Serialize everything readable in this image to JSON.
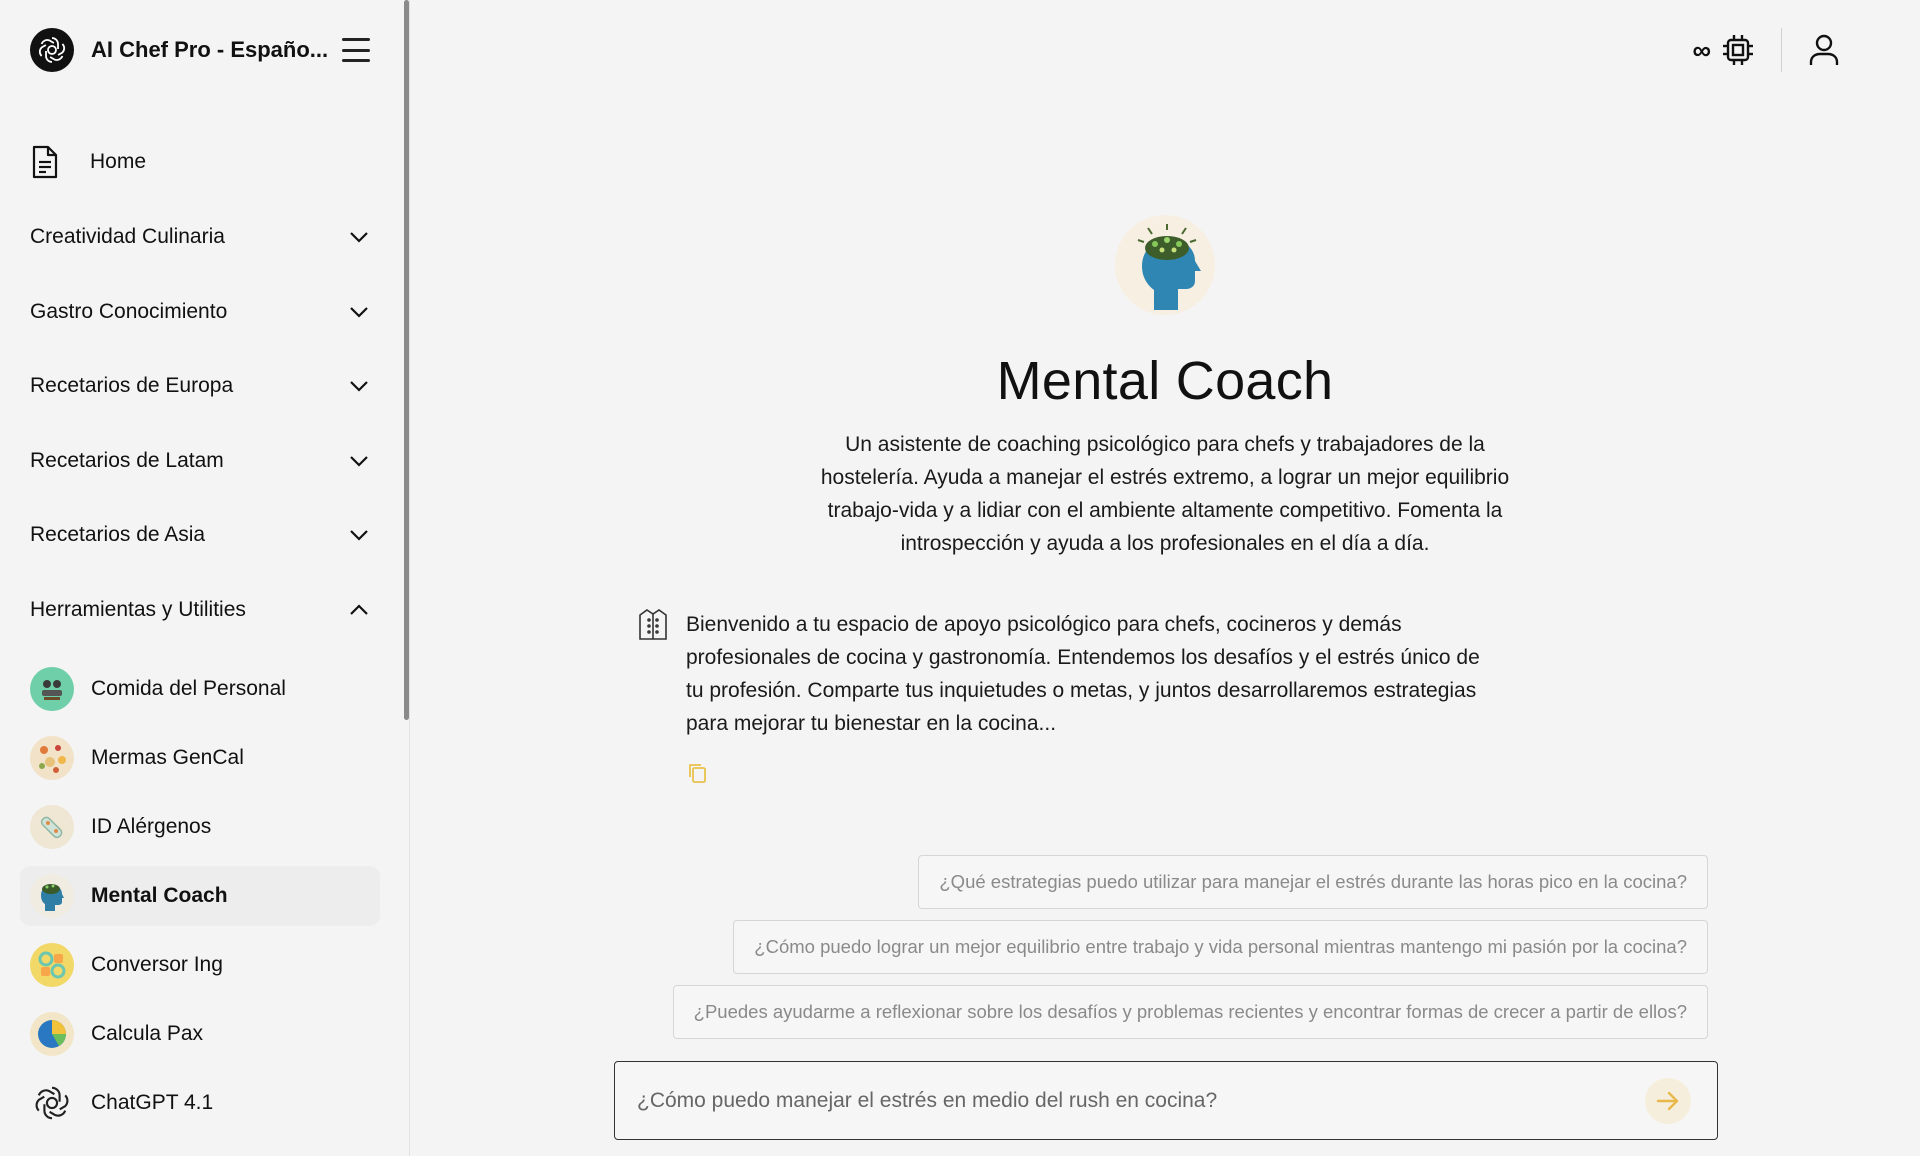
{
  "app": {
    "title": "AI Chef Pro - Españo..."
  },
  "sidebar": {
    "home_label": "Home",
    "sections": [
      {
        "label": "Creatividad Culinaria",
        "state": "collapsed"
      },
      {
        "label": "Gastro Conocimiento",
        "state": "collapsed"
      },
      {
        "label": "Recetarios de Europa",
        "state": "collapsed"
      },
      {
        "label": "Recetarios de Latam",
        "state": "collapsed"
      },
      {
        "label": "Recetarios de Asia",
        "state": "collapsed"
      },
      {
        "label": "Herramientas y Utilities",
        "state": "expanded"
      }
    ],
    "tools": [
      {
        "label": "Comida del Personal",
        "icon": "staff-meal-icon"
      },
      {
        "label": "Mermas GenCal",
        "icon": "ingredients-icon"
      },
      {
        "label": "ID Alérgenos",
        "icon": "allergens-icon"
      },
      {
        "label": "Mental Coach",
        "icon": "mental-coach-icon",
        "active": true
      },
      {
        "label": "Conversor Ing",
        "icon": "converter-icon"
      },
      {
        "label": "Calcula Pax",
        "icon": "pie-chart-icon"
      },
      {
        "label": "ChatGPT 4.1",
        "icon": "openai-icon"
      }
    ]
  },
  "topbar": {
    "infinity": "∞"
  },
  "main": {
    "title": "Mental Coach",
    "description": "Un asistente de coaching psicológico para chefs y trabajadores de la hostelería. Ayuda a manejar el estrés extremo, a lograr un mejor equilibrio trabajo-vida y a lidiar con el ambiente altamente competitivo. Fomenta la introspección y ayuda a los profesionales en el día a día.",
    "bot_message": "Bienvenido a tu espacio de apoyo psicológico para chefs, cocineros y demás profesionales de cocina y gastronomía. Entendemos los desafíos y el estrés único de tu profesión. Comparte tus inquietudes o metas, y juntos desarrollaremos estrategias para mejorar tu bienestar en la cocina...",
    "suggestions": [
      "¿Qué estrategias puedo utilizar para manejar el estrés durante las horas pico en la cocina?",
      "¿Cómo puedo lograr un mejor equilibrio entre trabajo y vida personal mientras mantengo mi pasión por la cocina?",
      "¿Puedes ayudarme a reflexionar sobre los desafíos y problemas recientes y encontrar formas de crecer a partir de ellos?"
    ],
    "input_placeholder": "¿Cómo puedo manejar el estrés en medio del rush en cocina?"
  },
  "colors": {
    "background": "#f4f4f4",
    "accent": "#e8b84a",
    "text": "#111111",
    "muted": "#8a8a8a"
  }
}
